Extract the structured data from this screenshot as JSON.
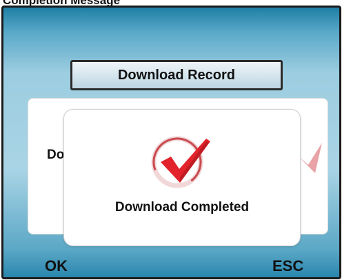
{
  "caption": "Completion Message",
  "header": {
    "title": "Download Record"
  },
  "background_dialog": {
    "text_fragment": "Do"
  },
  "dialog": {
    "icon": "checkmark-icon",
    "message": "Download Completed"
  },
  "softkeys": {
    "ok": "OK",
    "esc": "ESC"
  },
  "colors": {
    "screen_top": "#1f7fa6",
    "screen_mid": "#a9d4e5",
    "check_red": "#e2232b",
    "ring": "#c94a4f"
  }
}
